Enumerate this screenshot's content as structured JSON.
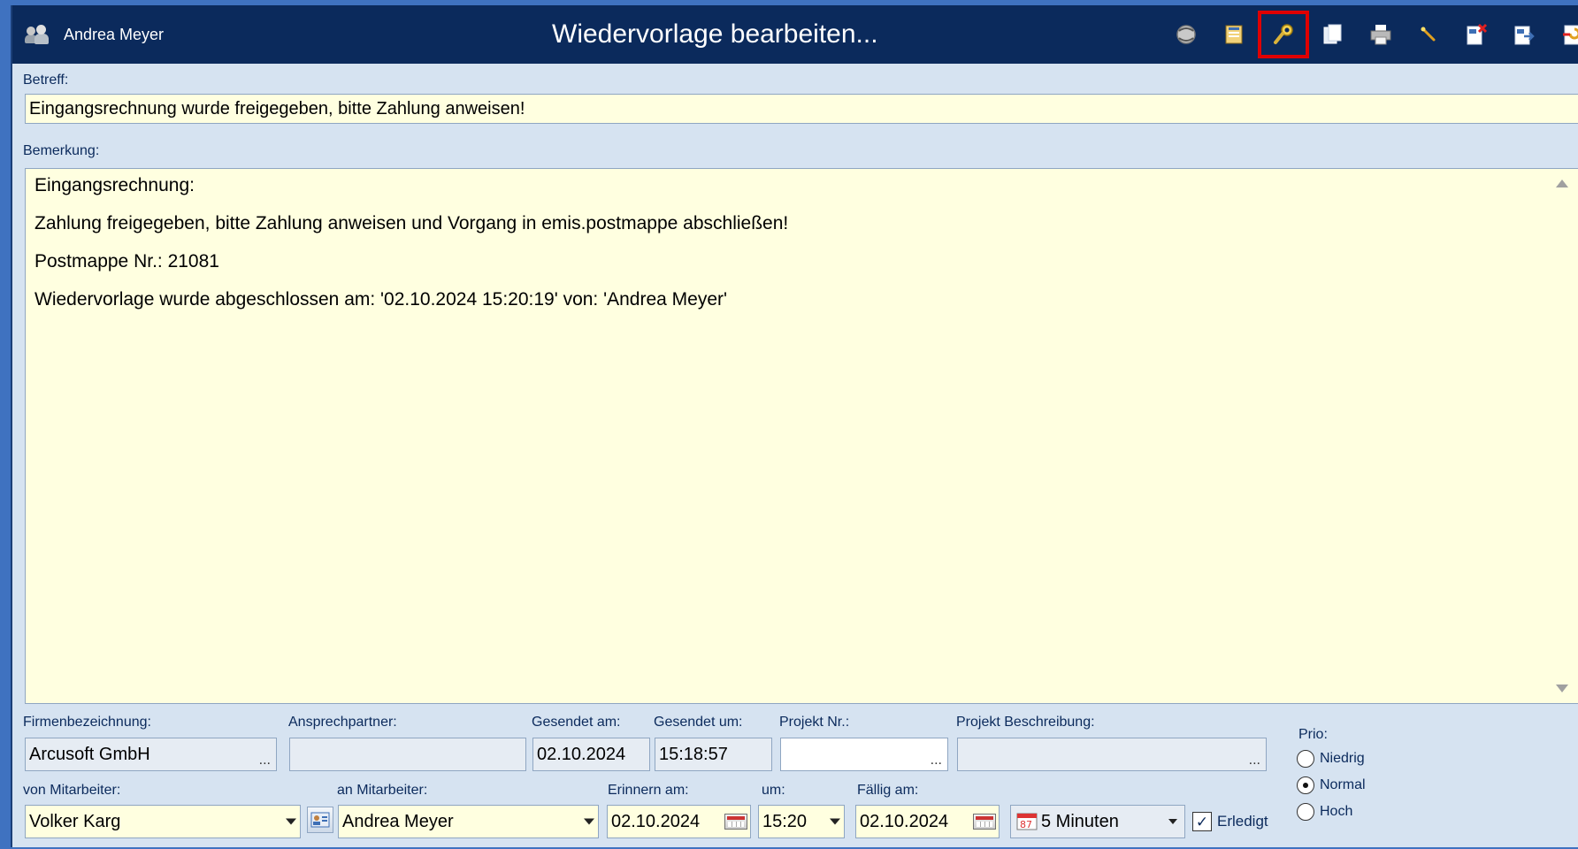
{
  "window": {
    "user": "Andrea Meyer",
    "title": "Wiedervorlage bearbeiten..."
  },
  "toolbar": {
    "icons": [
      "spiral-icon",
      "book-icon",
      "search-key-icon",
      "copy-icon",
      "print-icon",
      "wand-icon",
      "delete-document-icon",
      "export-document-icon",
      "close-window-icon"
    ],
    "selected_index": 2
  },
  "subject": {
    "label": "Betreff:",
    "value": "Eingangsrechnung wurde freigegeben, bitte Zahlung anweisen!"
  },
  "remarks": {
    "label": "Bemerkung:",
    "lines": [
      "Eingangsrechnung:",
      "Zahlung freigegeben, bitte Zahlung anweisen und Vorgang in emis.postmappe abschließen!",
      "Postmappe Nr.: 21081",
      "Wiedervorlage wurde abgeschlossen am: '02.10.2024 15:20:19' von: 'Andrea Meyer'"
    ]
  },
  "fields": {
    "company_label": "Firmenbezeichnung:",
    "company_value": "Arcusoft GmbH",
    "contact_label": "Ansprechpartner:",
    "contact_value": "",
    "sent_on_label": "Gesendet am:",
    "sent_on_value": "02.10.2024",
    "sent_at_label": "Gesendet um:",
    "sent_at_value": "15:18:57",
    "project_no_label": "Projekt Nr.:",
    "project_no_value": "",
    "project_desc_label": "Projekt Beschreibung:",
    "project_desc_value": "",
    "from_label": "von Mitarbeiter:",
    "from_value": "Volker Karg",
    "to_label": "an Mitarbeiter:",
    "to_value": "Andrea Meyer",
    "remind_label": "Erinnern am:",
    "remind_value": "02.10.2024",
    "time_label": "um:",
    "time_value": "15:20",
    "due_label": "Fällig am:",
    "due_value": "02.10.2024",
    "snooze_value": "5 Minuten",
    "done_label": "Erledigt",
    "done_checked": true,
    "ellipsis": "..."
  },
  "priority": {
    "label": "Prio:",
    "options": [
      "Niedrig",
      "Normal",
      "Hoch"
    ],
    "selected": "Normal"
  },
  "colors": {
    "titlebar": "#0b2a5c",
    "window_bg": "#d6e3f1",
    "field_bg": "#ffffe0",
    "highlight": "#e00000"
  }
}
